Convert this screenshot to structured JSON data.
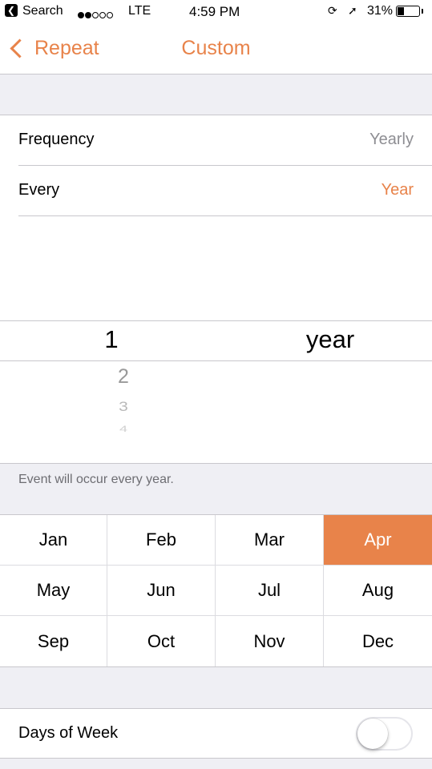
{
  "status_bar": {
    "back_app": "Search",
    "carrier": "LTE",
    "time": "4:59 PM",
    "battery": "31%",
    "battery_level": 0.31
  },
  "nav": {
    "back_label": "Repeat",
    "title": "Custom"
  },
  "settings": {
    "frequency_label": "Frequency",
    "frequency_value": "Yearly",
    "every_label": "Every",
    "every_value": "Year"
  },
  "picker": {
    "selected_number": "1",
    "unit": "year",
    "next_numbers": [
      "2",
      "3",
      "4"
    ]
  },
  "note": "Event will occur every year.",
  "months": [
    "Jan",
    "Feb",
    "Mar",
    "Apr",
    "May",
    "Jun",
    "Jul",
    "Aug",
    "Sep",
    "Oct",
    "Nov",
    "Dec"
  ],
  "selected_month": "Apr",
  "days_of_week": {
    "label": "Days of Week",
    "enabled": false
  },
  "colors": {
    "accent": "#e8834a",
    "secondary_text": "#8e8e93",
    "background": "#efeff4"
  }
}
